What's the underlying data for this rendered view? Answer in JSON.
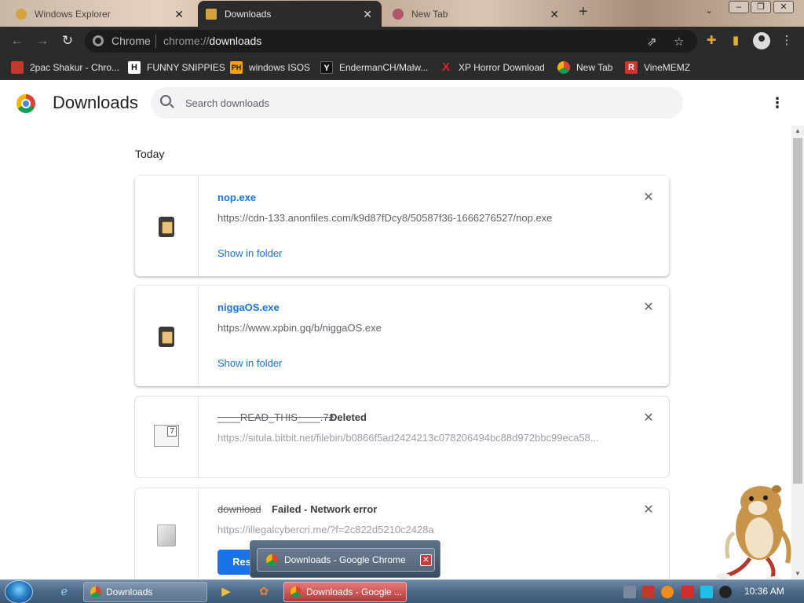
{
  "tabs": [
    {
      "title": "Windows Explorer",
      "active": false
    },
    {
      "title": "Downloads",
      "active": true
    },
    {
      "title": "New Tab",
      "active": false
    }
  ],
  "omnibox": {
    "chip_label": "Chrome",
    "url_prefix": "chrome://",
    "url_path": "downloads"
  },
  "bookmarks": [
    {
      "label": "2pac Shakur - Chro...",
      "icon": "gift-icon",
      "color": "#c0392b"
    },
    {
      "label": "FUNNY SNIPPIES",
      "icon": "H",
      "color": "#2b2b2b"
    },
    {
      "label": "windows ISOS",
      "icon": "PH",
      "color": "#f7a400"
    },
    {
      "label": "EndermanCH/Malw...",
      "icon": "Y",
      "color": "#111111"
    },
    {
      "label": "XP Horror Download",
      "icon": "X",
      "color": "#e02020"
    },
    {
      "label": "New Tab",
      "icon": "chrome-icon",
      "color": "#888888"
    },
    {
      "label": "VineMEMZ",
      "icon": "R",
      "color": "#d0342c"
    }
  ],
  "page": {
    "title": "Downloads",
    "search_placeholder": "Search downloads",
    "section_date": "Today"
  },
  "downloads": [
    {
      "name": "nop.exe",
      "status": "",
      "url": "https://cdn-133.anonfiles.com/k9d87fDcy8/50587f36-1666276527/nop.exe",
      "action": "Show in folder"
    },
    {
      "name": "niggaOS.exe",
      "status": "",
      "url": "https://www.xpbin.gq/b/niggaOS.exe",
      "action": "Show in folder"
    },
    {
      "name": "____READ_THIS____.7z",
      "status": "Deleted",
      "url": "https://situla.bitbit.net/filebin/b0866f5ad2424213c078206494bc88d972bbc99eca58...",
      "action": ""
    },
    {
      "name": "download",
      "status": "Failed - Network error",
      "url": "https://illegalcybercri.me/?f=2c822d5210c2428a",
      "action": "Resu"
    }
  ],
  "taskbar": {
    "buttons": [
      "Downloads",
      "Downloads - Google ..."
    ],
    "popup_title": "Downloads - Google Chrome",
    "clock": "10:36 AM"
  },
  "colors": {
    "accent": "#1a73e8",
    "toolbar": "#2b2b2b",
    "taskbar": "#4a6785"
  }
}
